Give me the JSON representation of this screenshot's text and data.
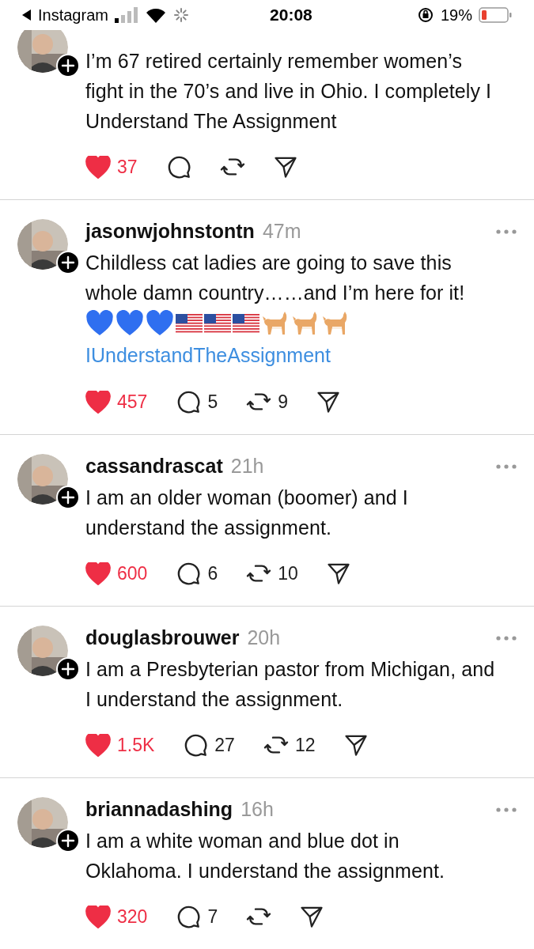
{
  "status_bar": {
    "back_label": "Instagram",
    "time": "20:08",
    "battery": "19%"
  },
  "posts": [
    {
      "body": "I’m 67 retired certainly remember women’s fight in the 70’s and live in Ohio. I completely I Understand The Assignment",
      "liked": true,
      "likes": "37"
    },
    {
      "username": "jasonwjohnstontn",
      "time": "47m",
      "body": "Childless cat ladies are going to save this whole damn country……and I’m here for it!",
      "emojis": [
        {
          "kind": "heart"
        },
        {
          "kind": "heart"
        },
        {
          "kind": "heart"
        },
        {
          "kind": "flag"
        },
        {
          "kind": "flag"
        },
        {
          "kind": "flag"
        },
        {
          "kind": "cat"
        },
        {
          "kind": "cat"
        },
        {
          "kind": "cat"
        }
      ],
      "tag": "IUnderstandTheAssignment",
      "liked": true,
      "likes": "457",
      "comments": "5",
      "reposts": "9"
    },
    {
      "username": "cassandrascat",
      "time": "21h",
      "body": "I am an older woman (boomer) and I understand the assignment.",
      "liked": true,
      "likes": "600",
      "comments": "6",
      "reposts": "10"
    },
    {
      "username": "douglasbrouwer",
      "time": "20h",
      "body": "I am a Presbyterian pastor from Michigan, and I understand the assignment.",
      "liked": true,
      "likes": "1.5K",
      "comments": "27",
      "reposts": "12"
    },
    {
      "username": "briannadashing",
      "time": "16h",
      "body": "I am a white woman and blue dot in Oklahoma. I understand the assignment.",
      "liked": true,
      "likes": "320",
      "comments": "7"
    }
  ]
}
